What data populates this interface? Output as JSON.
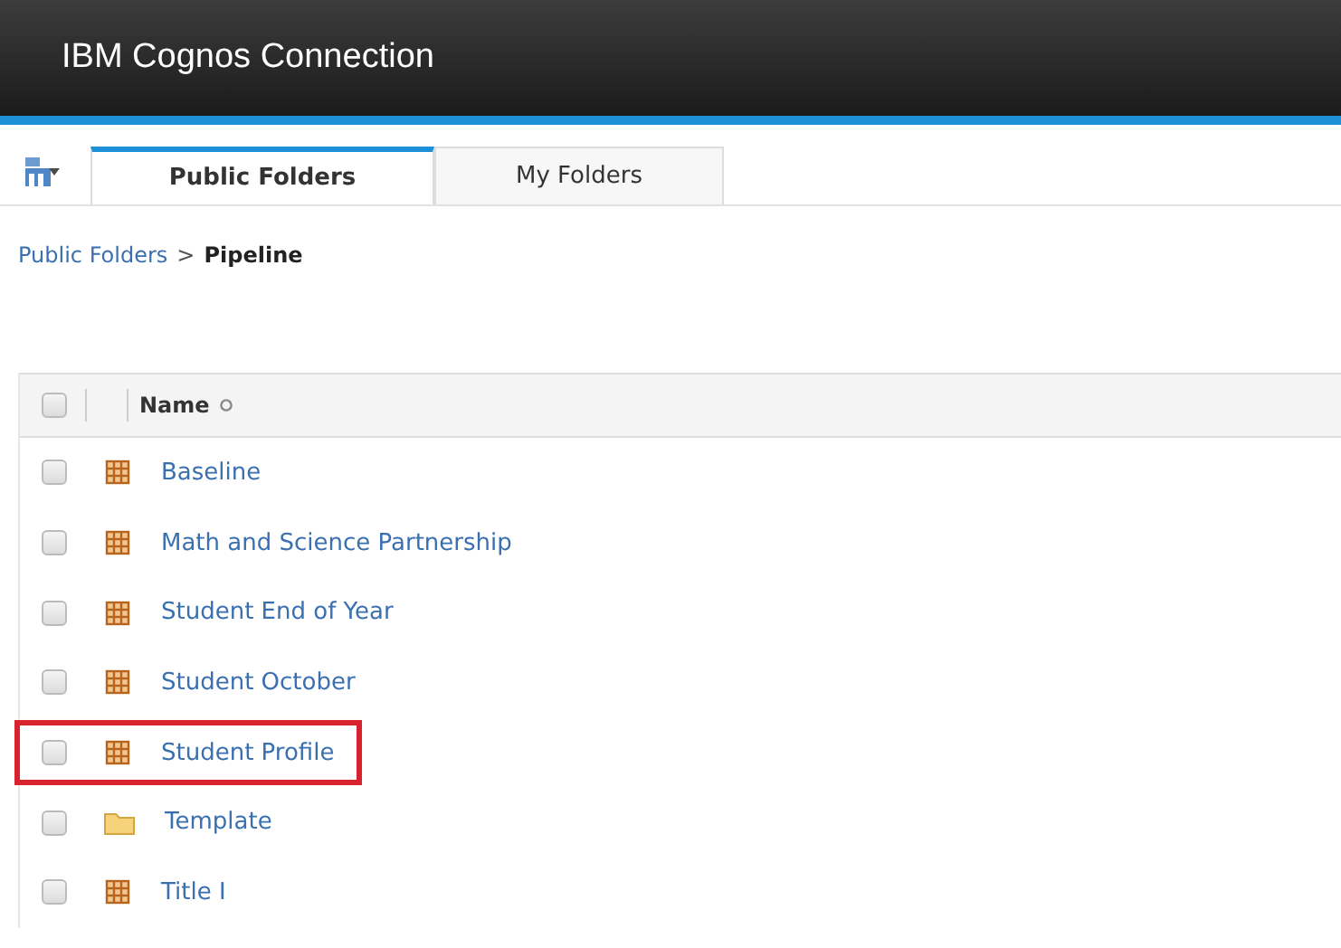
{
  "header": {
    "title": "IBM Cognos Connection"
  },
  "tabs": [
    {
      "label": "Public Folders",
      "selected": true
    },
    {
      "label": "My Folders",
      "selected": false
    }
  ],
  "breadcrumb": {
    "parent": "Public Folders",
    "separator": ">",
    "current": "Pipeline"
  },
  "table": {
    "select_all_checked": false,
    "columns": [
      {
        "label": "Name",
        "sortable": true
      }
    ],
    "rows": [
      {
        "name": "Baseline",
        "kind": "report",
        "checked": false,
        "highlighted": false
      },
      {
        "name": "Math and Science Partnership",
        "kind": "report",
        "checked": false,
        "highlighted": false
      },
      {
        "name": "Student End of Year",
        "kind": "report",
        "checked": false,
        "highlighted": false
      },
      {
        "name": "Student October",
        "kind": "report",
        "checked": false,
        "highlighted": false
      },
      {
        "name": "Student Profile",
        "kind": "report",
        "checked": false,
        "highlighted": true
      },
      {
        "name": "Template",
        "kind": "folder",
        "checked": false,
        "highlighted": false
      },
      {
        "name": "Title I",
        "kind": "report",
        "checked": false,
        "highlighted": false
      }
    ]
  }
}
